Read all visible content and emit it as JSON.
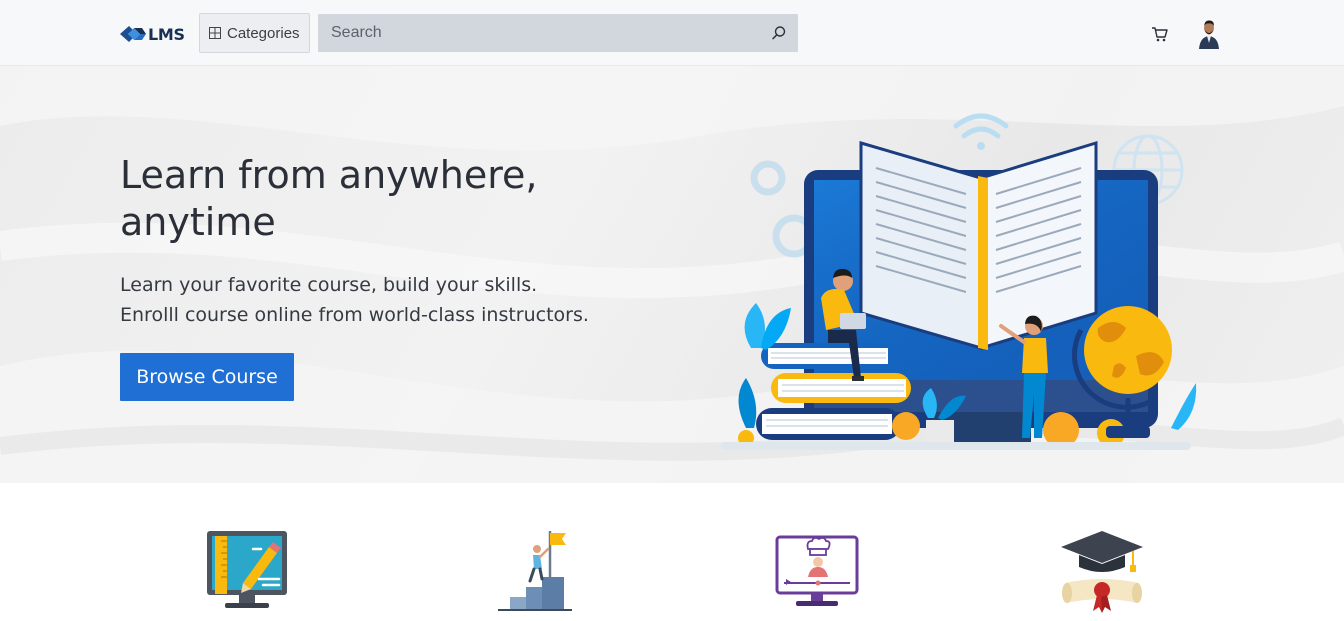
{
  "header": {
    "logo_text": "LMS",
    "categories_label": "Categories",
    "search_placeholder": "Search"
  },
  "hero": {
    "title": "Learn from anywhere, anytime",
    "subtitle_line1": "Learn your favorite course, build your skills.",
    "subtitle_line2": "Enrolll course online from world-class instructors.",
    "cta_label": "Browse Course"
  },
  "colors": {
    "primary": "#1f6fd4",
    "logo_navy": "#183153",
    "illustration_blue": "#1565c0",
    "illustration_yellow": "#f9b90e"
  },
  "icons": {
    "header": [
      "lms-logo-icon",
      "grid-icon",
      "search-icon",
      "cart-icon",
      "user-avatar"
    ],
    "features": [
      "design-monitor-icon",
      "goal-flag-icon",
      "online-cooking-class-icon",
      "graduation-cap-icon"
    ]
  }
}
